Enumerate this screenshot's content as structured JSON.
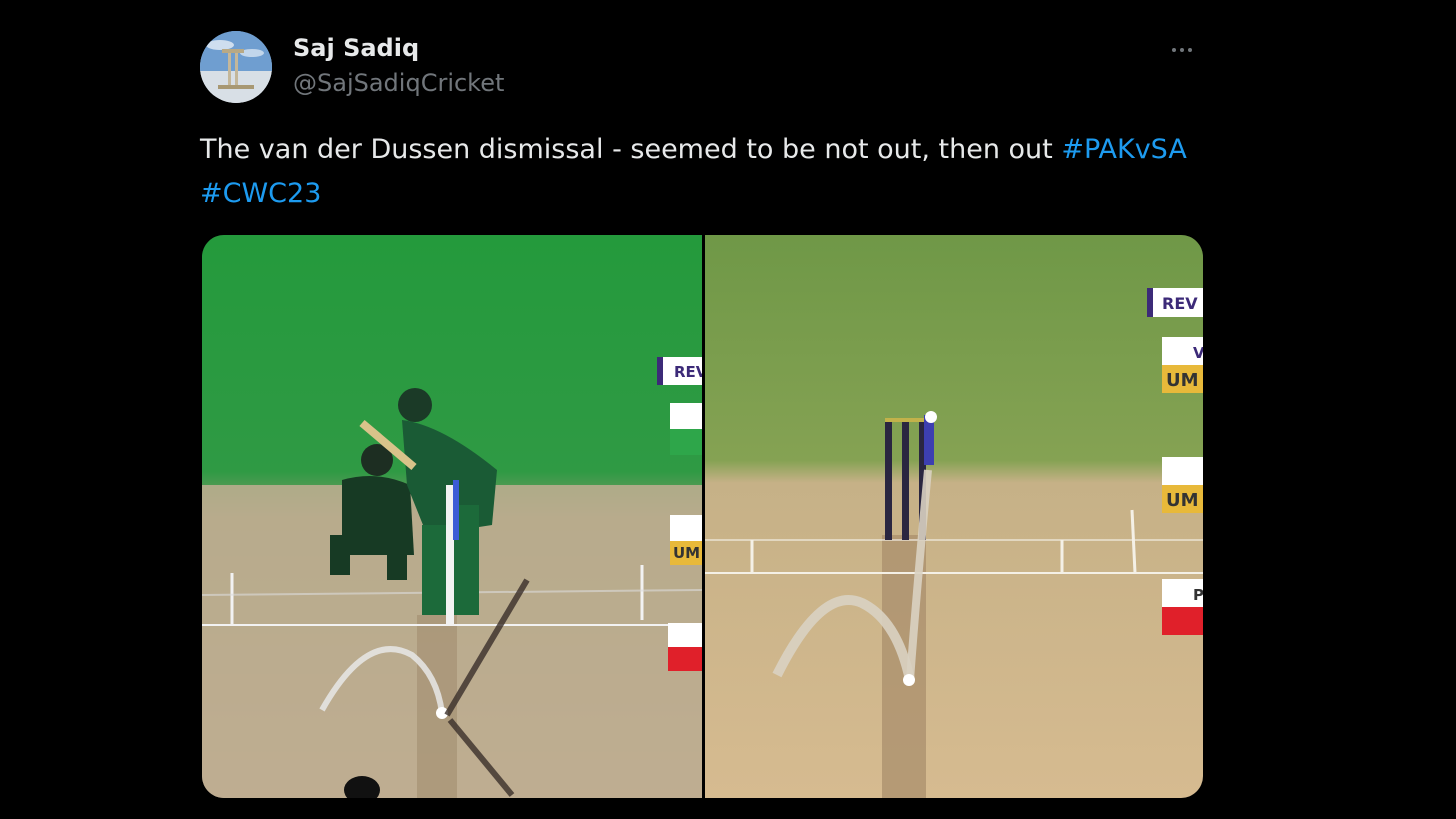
{
  "author": {
    "display_name": "Saj Sadiq",
    "handle": "@SajSadiqCricket",
    "avatar_icon": "stadium-avatar"
  },
  "menu": {
    "icon": "more-horizontal-icon"
  },
  "tweet": {
    "text": "The van der Dussen dismissal - seemed to be not out, then out",
    "hashtags": [
      "#PAKvSA",
      "#CWC23"
    ]
  },
  "media": {
    "left_overlay": {
      "review_badge": "REV",
      "umpire_label": "UM"
    },
    "right_overlay": {
      "review_badge": "REV",
      "umpire_label_1": "UM",
      "umpire_label_2": "UM",
      "white_tag_letter": "V",
      "red_tag_letter": "P"
    }
  },
  "colors": {
    "background": "#000000",
    "primary_text": "#e7e9ea",
    "secondary_text": "#71767b",
    "link": "#1d9bf0",
    "grass_left": "#2f9a44",
    "grass_right": "#7fa14f",
    "pitch_left": "#b9a98e",
    "pitch_right": "#cdb48a",
    "review_purple": "#3c2a78",
    "umpire_yellow": "#e8b93a",
    "decision_red": "#e0202a"
  }
}
